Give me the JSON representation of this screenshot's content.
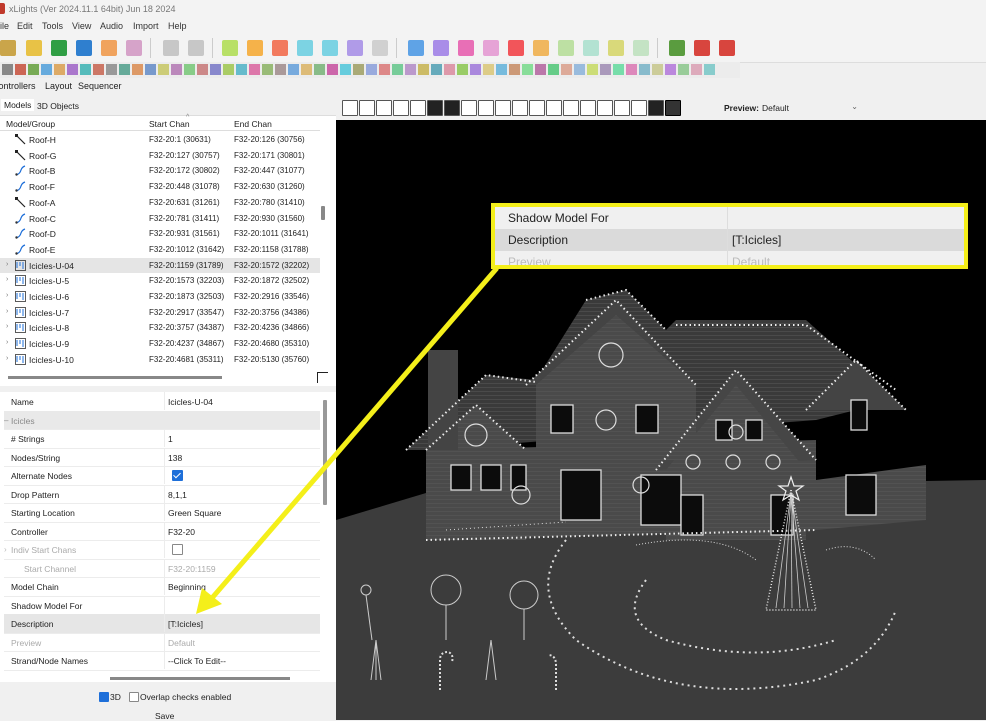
{
  "window": {
    "title": "xLights (Ver 2024.11.1 64bit) Jun 18 2024"
  },
  "menu": {
    "file": "ile",
    "edit": "Edit",
    "tools": "Tools",
    "view": "View",
    "audio": "Audio",
    "import": "Import",
    "help": "Help"
  },
  "tabs_top": {
    "controllers": "Controllers",
    "layout": "Layout",
    "sequencer": "Sequencer"
  },
  "tabs_panel": {
    "models": "Models",
    "objects_3d": "3D Objects"
  },
  "grid": {
    "headers": {
      "model": "Model/Group",
      "start": "Start Chan",
      "end": "End Chan"
    },
    "rows": [
      {
        "name": "Roof-H",
        "start": "F32-20:1 (30631)",
        "end": "F32-20:126 (30756)"
      },
      {
        "name": "Roof-G",
        "start": "F32-20:127 (30757)",
        "end": "F32-20:171 (30801)"
      },
      {
        "name": "Roof-B",
        "start": "F32-20:172 (30802)",
        "end": "F32-20:447 (31077)"
      },
      {
        "name": "Roof-F",
        "start": "F32-20:448 (31078)",
        "end": "F32-20:630 (31260)"
      },
      {
        "name": "Roof-A",
        "start": "F32-20:631 (31261)",
        "end": "F32-20:780 (31410)"
      },
      {
        "name": "Roof-C",
        "start": "F32-20:781 (31411)",
        "end": "F32-20:930 (31560)"
      },
      {
        "name": "Roof-D",
        "start": "F32-20:931 (31561)",
        "end": "F32-20:1011 (31641)"
      },
      {
        "name": "Roof-E",
        "start": "F32-20:1012 (31642)",
        "end": "F32-20:1158 (31788)"
      },
      {
        "name": "Icicles-U-04",
        "start": "F32-20:1159 (31789)",
        "end": "F32-20:1572 (32202)"
      },
      {
        "name": "Icicles-U-5",
        "start": "F32-20:1573 (32203)",
        "end": "F32-20:1872 (32502)"
      },
      {
        "name": "Icicles-U-6",
        "start": "F32-20:1873 (32503)",
        "end": "F32-20:2916 (33546)"
      },
      {
        "name": "Icicles-U-7",
        "start": "F32-20:2917 (33547)",
        "end": "F32-20:3756 (34386)"
      },
      {
        "name": "Icicles-U-8",
        "start": "F32-20:3757 (34387)",
        "end": "F32-20:4236 (34866)"
      },
      {
        "name": "Icicles-U-9",
        "start": "F32-20:4237 (34867)",
        "end": "F32-20:4680 (35310)"
      },
      {
        "name": "Icicles-U-10",
        "start": "F32-20:4681 (35311)",
        "end": "F32-20:5130 (35760)"
      }
    ]
  },
  "props": {
    "name_k": "Name",
    "name_v": "Icicles-U-04",
    "cat": "Icicles",
    "strings_k": "# Strings",
    "strings_v": "1",
    "nodes_k": "Nodes/String",
    "nodes_v": "138",
    "alt_k": "Alternate Nodes",
    "drop_k": "Drop Pattern",
    "drop_v": "8,1,1",
    "start_loc_k": "Starting Location",
    "start_loc_v": "Green Square",
    "controller_k": "Controller",
    "controller_v": "F32-20",
    "indiv_k": "Indiv Start Chans",
    "start_chan_k": "Start Channel",
    "start_chan_v": "F32-20:1159",
    "model_chain_k": "Model Chain",
    "model_chain_v": "Beginning",
    "shadow_k": "Shadow Model For",
    "desc_k": "Description",
    "desc_v": "[T:Icicles]",
    "preview_k": "Preview",
    "preview_v": "Default",
    "strand_k": "Strand/Node Names",
    "strand_v": "--Click To Edit--"
  },
  "bottom": {
    "three_d": "3D",
    "overlap": "Overlap checks enabled",
    "save": "Save"
  },
  "viewport_toolbar": {
    "preview_label": "Preview:",
    "preview_value": "Default"
  },
  "callout": {
    "shadow_k": "Shadow Model For",
    "desc_k": "Description",
    "desc_v": "[T:Icicles]",
    "preview_k": "Preview",
    "preview_v": "Default"
  },
  "colors": {
    "callout_border": "#f4ef1a",
    "checkbox_accent": "#1e6fd9",
    "viewport_bg": "#000000"
  }
}
